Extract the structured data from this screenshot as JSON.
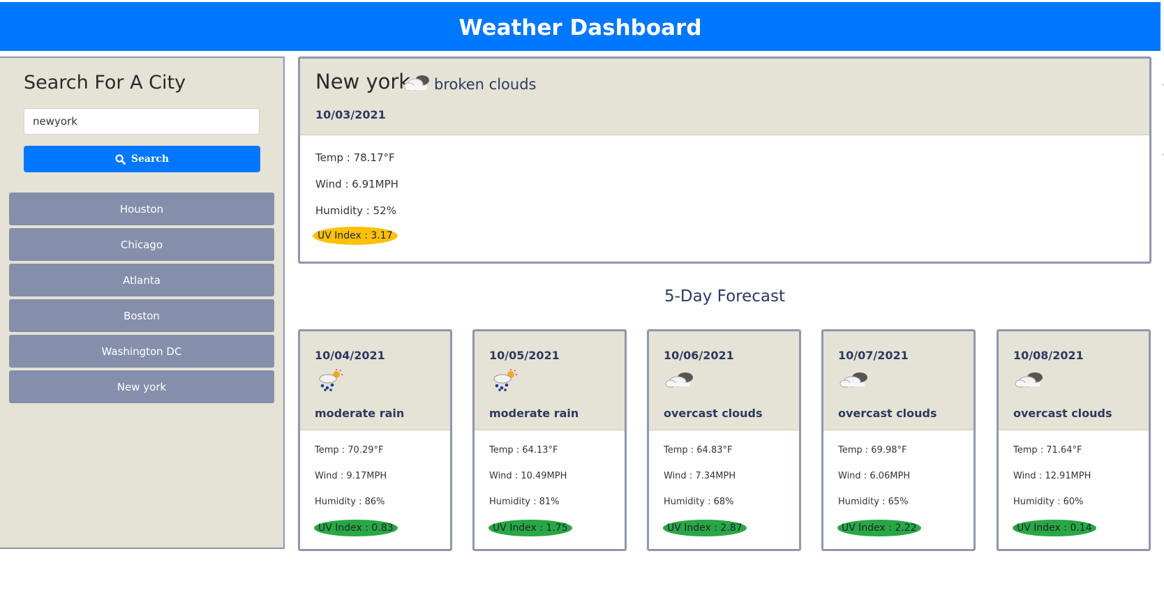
{
  "header": {
    "title": "Weather Dashboard"
  },
  "sidebar": {
    "title": "Search For A City",
    "search_value": "newyork",
    "search_button_label": "Search",
    "history": [
      "Houston",
      "Chicago",
      "Atlanta",
      "Boston",
      "Washington DC",
      "New york"
    ]
  },
  "current": {
    "city": "New york",
    "icon": "broken-clouds-icon",
    "description": "broken clouds",
    "date": "10/03/2021",
    "temp": "Temp : 78.17°F",
    "wind": "Wind : 6.91MPH",
    "humidity": "Humidity : 52%",
    "uv": "UV Index : 3.17",
    "uv_color": "#ffc107"
  },
  "forecast": {
    "title": "5-Day Forecast",
    "days": [
      {
        "date": "10/04/2021",
        "icon": "moderate-rain-icon",
        "description": "moderate rain",
        "temp": "Temp : 70.29°F",
        "wind": "Wind : 9.17MPH",
        "humidity": "Humidity : 86%",
        "uv": "UV Index : 0.83"
      },
      {
        "date": "10/05/2021",
        "icon": "moderate-rain-icon",
        "description": "moderate rain",
        "temp": "Temp : 64.13°F",
        "wind": "Wind : 10.49MPH",
        "humidity": "Humidity : 81%",
        "uv": "UV Index : 1.75"
      },
      {
        "date": "10/06/2021",
        "icon": "overcast-clouds-icon",
        "description": "overcast clouds",
        "temp": "Temp : 64.83°F",
        "wind": "Wind : 7.34MPH",
        "humidity": "Humidity : 68%",
        "uv": "UV Index : 2.87"
      },
      {
        "date": "10/07/2021",
        "icon": "overcast-clouds-icon",
        "description": "overcast clouds",
        "temp": "Temp : 69.98°F",
        "wind": "Wind : 6.06MPH",
        "humidity": "Humidity : 65%",
        "uv": "UV Index : 2.22"
      },
      {
        "date": "10/08/2021",
        "icon": "overcast-clouds-icon",
        "description": "overcast clouds",
        "temp": "Temp : 71.64°F",
        "wind": "Wind : 12.91MPH",
        "humidity": "Humidity : 60%",
        "uv": "UV Index : 0.14"
      }
    ]
  },
  "colors": {
    "header": "#0077ff",
    "panel": "#e5e2d6",
    "history_button": "#858fab",
    "uv_low": "#28a745",
    "uv_moderate": "#ffc107"
  }
}
